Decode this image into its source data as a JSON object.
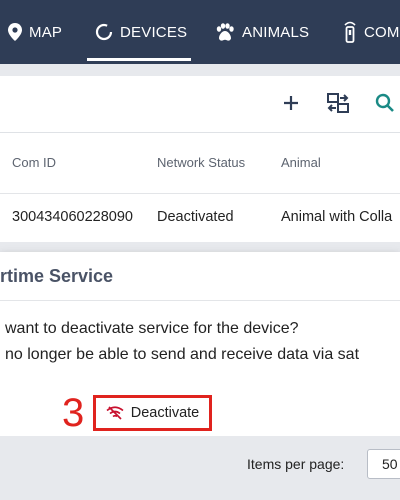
{
  "nav": {
    "items": [
      {
        "label": "MAP",
        "icon": "map-pin-icon"
      },
      {
        "label": "DEVICES",
        "icon": "devices-ring-icon",
        "active": true
      },
      {
        "label": "ANIMALS",
        "icon": "paw-icon"
      },
      {
        "label": "COM",
        "icon": "tracker-icon"
      }
    ]
  },
  "toolbar": {
    "icons": [
      "add-icon",
      "transfer-icon",
      "search-icon"
    ]
  },
  "table": {
    "columns": [
      "Com ID",
      "Network Status",
      "Animal"
    ],
    "rows": [
      {
        "com_id": "300434060228090",
        "network_status": "Deactivated",
        "animal": "Animal with Colla"
      }
    ]
  },
  "dialog": {
    "title": "rtime Service",
    "line1": "want to deactivate service for the device?",
    "line2": "no longer be able to send and receive data via sat",
    "deactivate_label": "Deactivate",
    "annotation_number": "3"
  },
  "footer": {
    "items_per_page_label": "Items per page:",
    "items_per_page_value": "50"
  },
  "colors": {
    "nav_bg": "#2f3d56",
    "accent_teal": "#1a8a85",
    "annotation_red": "#e0231e",
    "danger_icon": "#c8102e"
  }
}
